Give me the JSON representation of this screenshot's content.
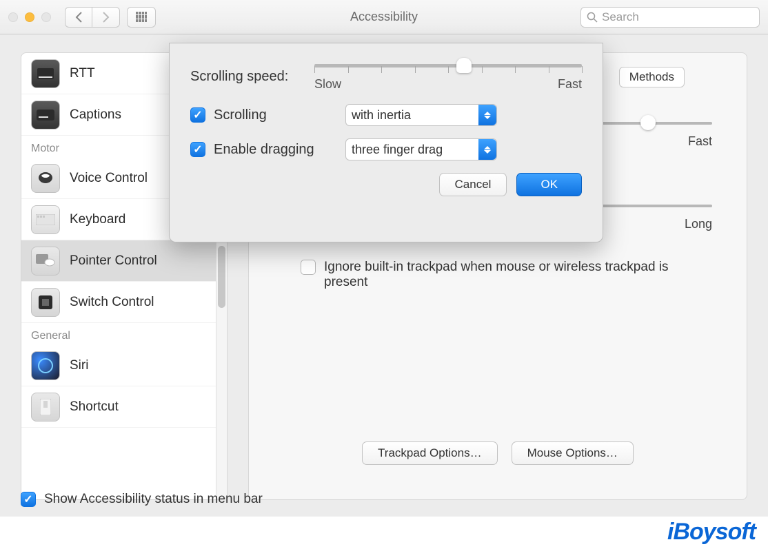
{
  "toolbar": {
    "title": "Accessibility",
    "search_placeholder": "Search"
  },
  "sidebar": {
    "items": [
      {
        "label": "RTT"
      },
      {
        "label": "Captions"
      }
    ],
    "section_motor": "Motor",
    "motor_items": [
      {
        "label": "Voice Control"
      },
      {
        "label": "Keyboard"
      },
      {
        "label": "Pointer Control"
      },
      {
        "label": "Switch Control"
      }
    ],
    "section_general": "General",
    "general_items": [
      {
        "label": "Siri"
      },
      {
        "label": "Shortcut"
      }
    ]
  },
  "panel": {
    "methods_tab": "Methods",
    "slider1_end": "Fast",
    "slider2_end": "Long",
    "ignore_label": "Ignore built-in trackpad when mouse or wireless trackpad is present",
    "trackpad_btn": "Trackpad Options…",
    "mouse_btn": "Mouse Options…"
  },
  "modal": {
    "scroll_speed_label": "Scrolling speed:",
    "slow_label": "Slow",
    "fast_label": "Fast",
    "scrolling_label": "Scrolling",
    "scrolling_value": "with inertia",
    "dragging_label": "Enable dragging",
    "dragging_value": "three finger drag",
    "cancel": "Cancel",
    "ok": "OK",
    "slider_position_pct": 55
  },
  "bottom": {
    "menubar_label": "Show Accessibility status in menu bar",
    "menubar_checked": true
  },
  "watermark": "iBoysoft"
}
